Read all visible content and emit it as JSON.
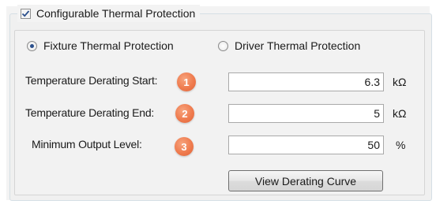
{
  "group": {
    "checked": true,
    "label": "Configurable Thermal Protection"
  },
  "protection_mode": {
    "options": [
      {
        "label": "Fixture Thermal Protection",
        "selected": true
      },
      {
        "label": "Driver Thermal Protection",
        "selected": false
      }
    ]
  },
  "fields": [
    {
      "label": "Temperature Derating Start:",
      "badge": "1",
      "value": "6.3",
      "unit": "kΩ"
    },
    {
      "label": "Temperature Derating End:",
      "badge": "2",
      "value": "5",
      "unit": "kΩ"
    },
    {
      "label": "Minimum Output Level:",
      "badge": "3",
      "value": "50",
      "unit": "%"
    }
  ],
  "view_curve_button": {
    "label": "View Derating Curve"
  },
  "colors": {
    "badge": "#ef7b4e",
    "frame": "#d5dfe5",
    "panel": "#f2f2f2",
    "radio_dot": "#2a4f8c",
    "checkmark": "#2a4f8c"
  }
}
